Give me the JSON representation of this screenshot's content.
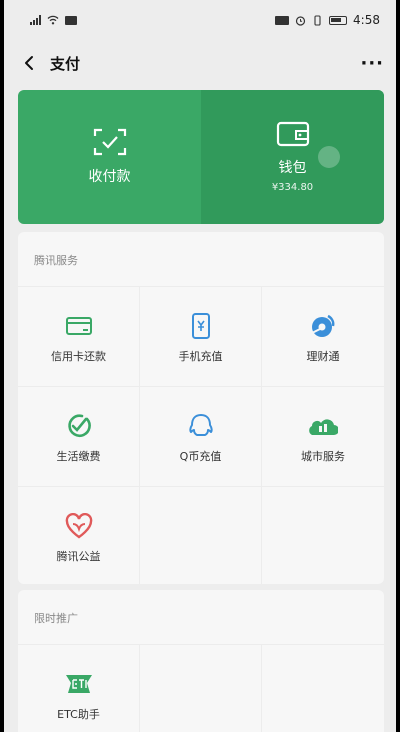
{
  "status_bar": {
    "time": "4:58"
  },
  "nav": {
    "title": "支付"
  },
  "hero": {
    "left_label": "收付款",
    "right_label": "钱包",
    "balance": "¥334.80"
  },
  "sections": [
    {
      "title": "腾讯服务",
      "items": [
        {
          "label": "信用卡还款",
          "icon": "credit-card-icon"
        },
        {
          "label": "手机充值",
          "icon": "phone-topup-icon"
        },
        {
          "label": "理财通",
          "icon": "wealth-icon"
        },
        {
          "label": "生活缴费",
          "icon": "utility-payment-icon"
        },
        {
          "label": "Q币充值",
          "icon": "qq-coin-icon"
        },
        {
          "label": "城市服务",
          "icon": "city-service-icon"
        },
        {
          "label": "腾讯公益",
          "icon": "charity-heart-icon"
        }
      ]
    },
    {
      "title": "限时推广",
      "items": [
        {
          "label": "ETC助手",
          "icon": "etc-icon"
        }
      ]
    }
  ],
  "colors": {
    "green": "#3aa866",
    "green_dark": "#319a5b",
    "blue": "#3b8fd9",
    "red": "#e05a5a"
  }
}
